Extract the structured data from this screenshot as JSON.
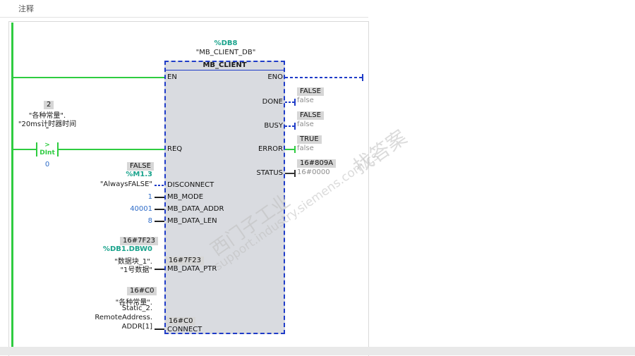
{
  "header": {
    "label": "注释"
  },
  "instance": {
    "db_name": "%DB8",
    "db_symbol": "\"MB_CLIENT_DB\""
  },
  "block": {
    "title": "MB_CLIENT",
    "inputs": {
      "en": "EN",
      "req": "REQ",
      "disconnect": "DISCONNECT",
      "mb_mode": "MB_MODE",
      "mb_data_addr": "MB_DATA_ADDR",
      "mb_data_len": "MB_DATA_LEN",
      "mb_data_ptr": "MB_DATA_PTR",
      "connect": "CONNECT"
    },
    "outputs": {
      "eno": "ENO",
      "done": "DONE",
      "busy": "BUSY",
      "error": "ERROR",
      "status": "STATUS"
    },
    "inner_values": {
      "mb_data_ptr": "16#7F23",
      "connect": "16#C0"
    }
  },
  "contact": {
    "top_value": "2",
    "operand_line1": "\"各种常量\".",
    "operand_line2": "\"20ms计时器时间",
    "operand_line3": "\"",
    "type": ">",
    "datatype": "DInt",
    "compare_value": "0"
  },
  "disconnect_param": {
    "monitor": "FALSE",
    "address": "%M1.3",
    "symbol": "\"AlwaysFALSE\""
  },
  "mb_mode_value": "1",
  "mb_data_addr_value": "40001",
  "mb_data_len_value": "8",
  "mb_data_ptr_param": {
    "monitor": "16#7F23",
    "address": "%DB1.DBW0",
    "symbol_line1": "\"数据块_1\".",
    "symbol_line2": "\"1号数据\""
  },
  "connect_param": {
    "monitor": "16#C0",
    "line1": "\"各种常量\".",
    "line2": "Static_2.",
    "line3": "RemoteAddress.",
    "line4": "ADDR[1]"
  },
  "outputs_monitor": {
    "done": {
      "live": "FALSE",
      "init": "false"
    },
    "busy": {
      "live": "FALSE",
      "init": "false"
    },
    "error": {
      "live": "TRUE",
      "init": "false"
    },
    "status": {
      "live": "16#809A",
      "init": "16#0000"
    }
  },
  "watermark": {
    "line1": "西门子工业",
    "line2": "support.industry.siemens.com/cs",
    "line3": "找答案"
  },
  "colors": {
    "power_flow": "#2ecc40",
    "no_flow": "#1f3cc8",
    "block_fill": "#d9dbe0",
    "address": "#1aa38c",
    "constant": "#2e6cc8"
  }
}
